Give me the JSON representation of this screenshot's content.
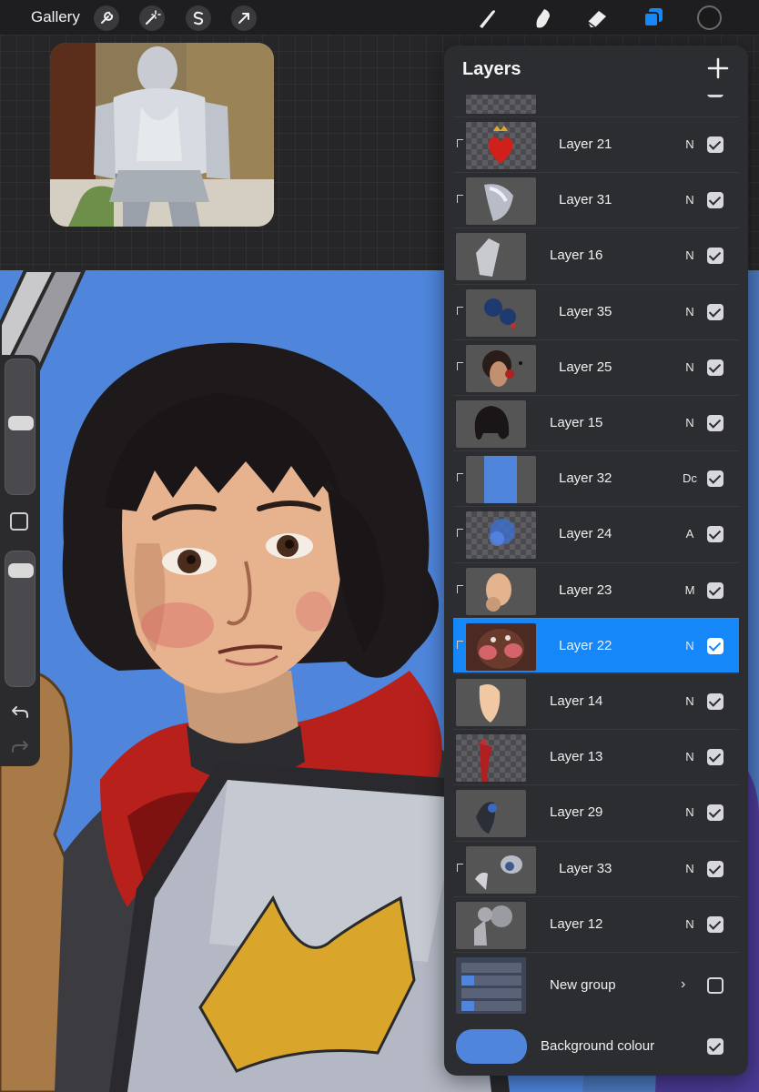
{
  "topbar": {
    "gallery_label": "Gallery",
    "left_tools": [
      "wrench-icon",
      "magic-wand-icon",
      "selection-s-icon",
      "transform-arrow-icon"
    ],
    "right_tools": [
      "brush-icon",
      "smudge-icon",
      "eraser-icon",
      "layers-icon"
    ],
    "active_tool": "layers-icon",
    "active_color": "#1a1a1a"
  },
  "colors": {
    "accent": "#1587f8",
    "canvas_background": "#4f86dc"
  },
  "layers_panel": {
    "title": "Layers",
    "add_icon": "plus-icon",
    "layers": [
      {
        "name": "Layer 21",
        "blend": "N",
        "visible": true,
        "clipped": true,
        "selected": false,
        "thumb": "heart-crown"
      },
      {
        "name": "Layer 31",
        "blend": "N",
        "visible": true,
        "clipped": true,
        "selected": false,
        "thumb": "armor-sheen"
      },
      {
        "name": "Layer 16",
        "blend": "N",
        "visible": true,
        "clipped": false,
        "selected": false,
        "thumb": "shield-shape"
      },
      {
        "name": "Layer 35",
        "blend": "N",
        "visible": true,
        "clipped": true,
        "selected": false,
        "thumb": "blue-dots"
      },
      {
        "name": "Layer 25",
        "blend": "N",
        "visible": true,
        "clipped": true,
        "selected": false,
        "thumb": "face-shadow"
      },
      {
        "name": "Layer 15",
        "blend": "N",
        "visible": true,
        "clipped": false,
        "selected": false,
        "thumb": "hair"
      },
      {
        "name": "Layer 32",
        "blend": "Dc",
        "visible": true,
        "clipped": true,
        "selected": false,
        "thumb": "blue-rect"
      },
      {
        "name": "Layer 24",
        "blend": "A",
        "visible": true,
        "clipped": true,
        "selected": false,
        "thumb": "blue-glow"
      },
      {
        "name": "Layer 23",
        "blend": "M",
        "visible": true,
        "clipped": true,
        "selected": false,
        "thumb": "skin-head"
      },
      {
        "name": "Layer 22",
        "blend": "N",
        "visible": true,
        "clipped": true,
        "selected": true,
        "thumb": "face-blush"
      },
      {
        "name": "Layer 14",
        "blend": "N",
        "visible": true,
        "clipped": false,
        "selected": false,
        "thumb": "skin-base"
      },
      {
        "name": "Layer 13",
        "blend": "N",
        "visible": true,
        "clipped": false,
        "selected": false,
        "thumb": "red-scarf"
      },
      {
        "name": "Layer 29",
        "blend": "N",
        "visible": true,
        "clipped": false,
        "selected": false,
        "thumb": "dark-armor"
      },
      {
        "name": "Layer 33",
        "blend": "N",
        "visible": true,
        "clipped": true,
        "selected": false,
        "thumb": "armor-pieces"
      },
      {
        "name": "Layer 12",
        "blend": "N",
        "visible": true,
        "clipped": false,
        "selected": false,
        "thumb": "grey-figure"
      }
    ],
    "group": {
      "name": "New group",
      "chevron": "›",
      "visible": false
    },
    "background": {
      "name": "Background colour",
      "color": "#4f86dc",
      "visible": true
    }
  },
  "sidebar": {
    "brush_size_level": 0.53,
    "opacity_level": 0.08,
    "icons": [
      "modify-square-icon",
      "undo-icon",
      "redo-icon"
    ]
  }
}
